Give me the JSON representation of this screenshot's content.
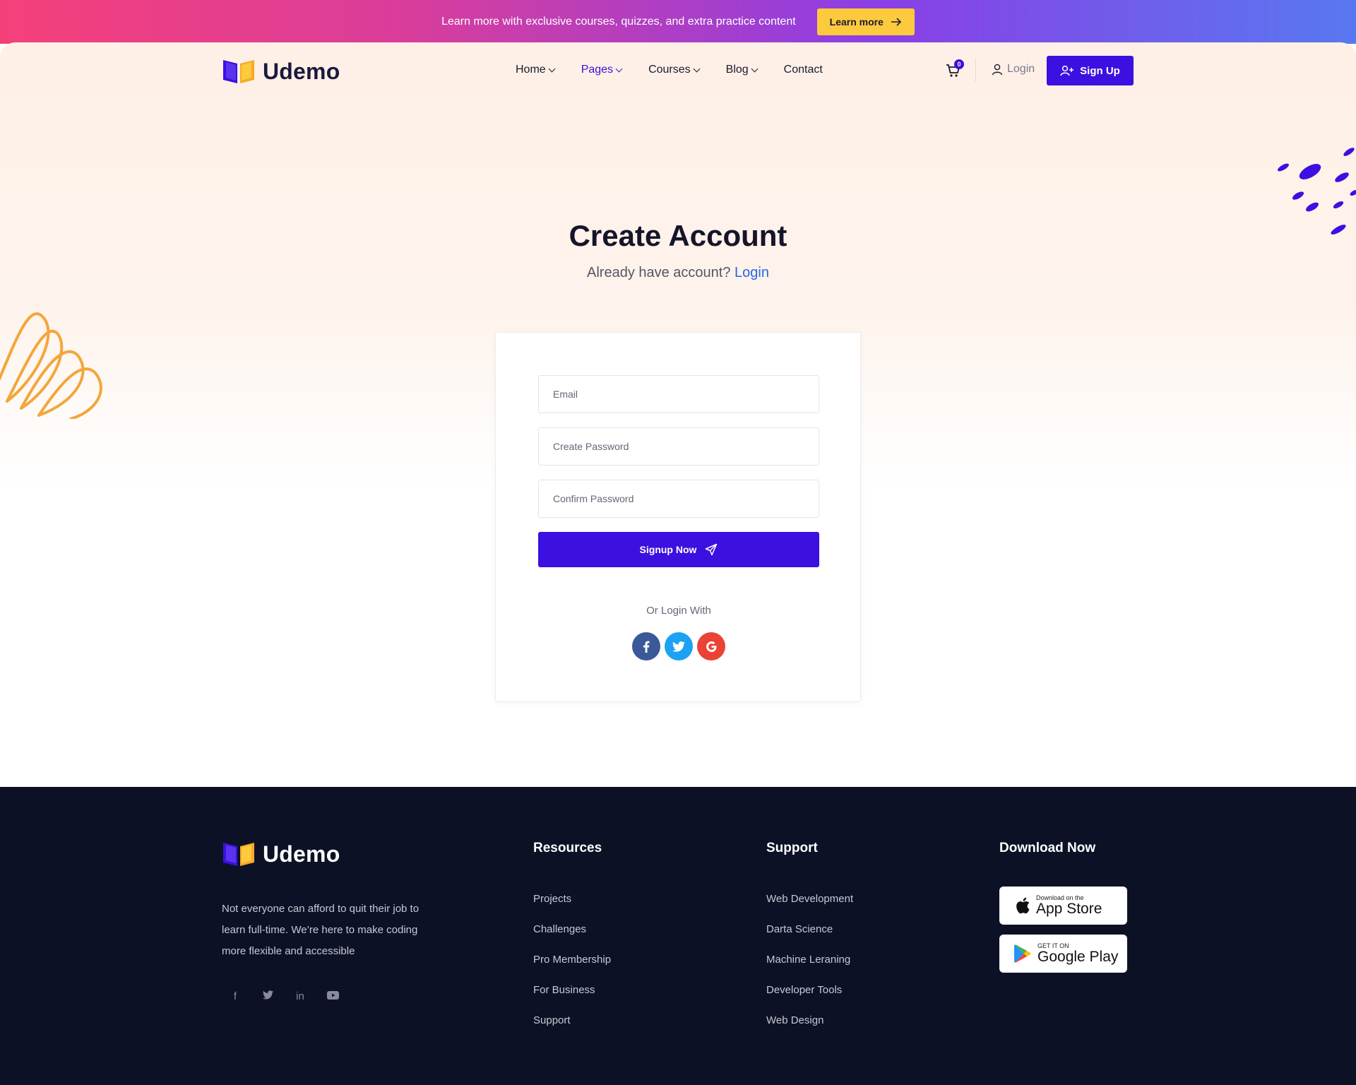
{
  "topbar": {
    "text": "Learn more with exclusive courses, quizzes, and extra practice content",
    "button_label": "Learn more"
  },
  "header": {
    "logo_text": "Udemo",
    "nav": [
      {
        "label": "Home",
        "dropdown": true
      },
      {
        "label": "Pages",
        "dropdown": true,
        "active": true
      },
      {
        "label": "Courses",
        "dropdown": true
      },
      {
        "label": "Blog",
        "dropdown": true
      },
      {
        "label": "Contact",
        "dropdown": false
      }
    ],
    "cart_count": "0",
    "login_label": "Login",
    "signup_label": "Sign Up"
  },
  "page": {
    "title": "Create Account",
    "subtitle": "Already have account?",
    "subtitle_link": "Login"
  },
  "form": {
    "email_placeholder": "Email",
    "password_placeholder": "Create Password",
    "confirm_placeholder": "Confirm Password",
    "submit_label": "Signup Now",
    "or_login_with": "Or Login With"
  },
  "footer": {
    "logo_text": "Udemo",
    "description": "Not everyone can afford to quit their job to learn full-time. We’re here to make coding more flexible and accessible",
    "columns": [
      {
        "title": "Resources",
        "links": [
          "Projects",
          "Challenges",
          "Pro Membership",
          "For Business",
          "Support"
        ]
      },
      {
        "title": "Support",
        "links": [
          "Web Development",
          "Darta Science",
          "Machine Leraning",
          "Developer Tools",
          "Web Design"
        ]
      }
    ],
    "download_title": "Download Now",
    "app_store": {
      "small": "Download on the",
      "big": "App Store"
    },
    "google_play": {
      "small": "GET IT ON",
      "big": "Google Play"
    }
  },
  "colors": {
    "primary": "#3b10e0",
    "accent_yellow": "#fdca3e",
    "footer_bg": "#0d1126",
    "link_blue": "#2666e8"
  }
}
